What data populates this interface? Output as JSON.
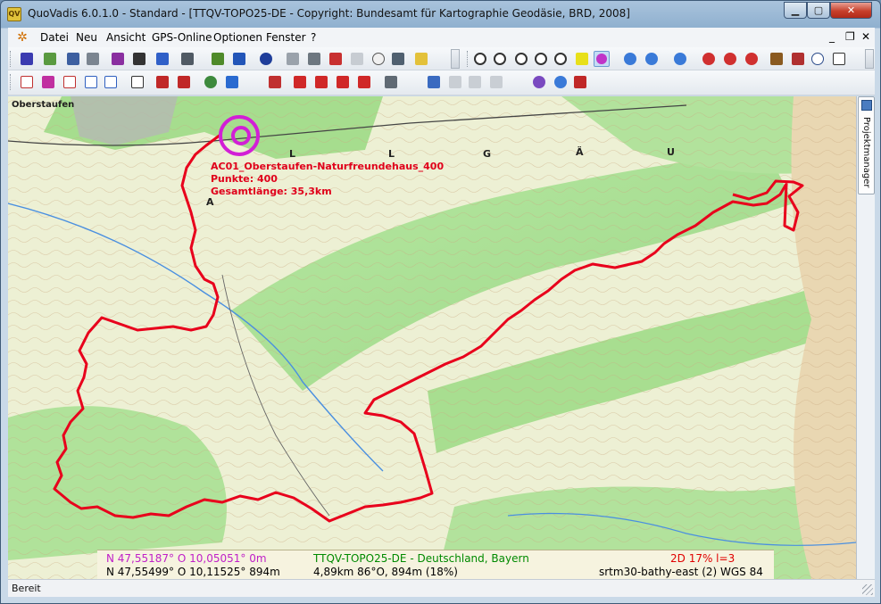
{
  "window": {
    "title": "QuoVadis 6.0.1.0 - Standard - [TTQV-TOPO25-DE - Copyright: Bundesamt für Kartographie Geodäsie, BRD, 2008]",
    "app_icon_text": "QV",
    "minimize_glyph": "▁",
    "maximize_glyph": "▢",
    "close_glyph": "✕"
  },
  "menu": {
    "items": [
      "Datei",
      "Neu",
      "Ansicht",
      "GPS-Online",
      "Optionen",
      "Fenster",
      "?"
    ],
    "mdi_minimize": "_",
    "mdi_restore": "❐",
    "mdi_close": "✕"
  },
  "map": {
    "town_label": "Oberstaufen",
    "region_letters": [
      "A",
      "L",
      "L",
      "G",
      "Ä",
      "U"
    ],
    "track": {
      "name": "AC01_Oberstaufen-Naturfreundehaus_400",
      "points": "Punkte: 400",
      "length": "Gesamtlänge: 35,3km"
    },
    "colors": {
      "track": "#e8001c",
      "marker": "#d21fd6",
      "forest": "#aee39a",
      "meadow": "#eef1d6"
    }
  },
  "coords": {
    "line1_left": "N 47,55187°  O 10,05051°  0m",
    "line1_mid": "TTQV-TOPO25-DE - Deutschland, Bayern",
    "line1_right": "2D  17%  l=3",
    "line2_left": "N 47,55499°  O 10,11525°  894m",
    "line2_mid": "4,89km 86°O,  894m (18%)",
    "line2_right": "srtm30-bathy-east (2)  WGS 84"
  },
  "sidepanel": {
    "tab_label": "Projektmanager"
  },
  "statusbar": {
    "text": "Bereit"
  }
}
